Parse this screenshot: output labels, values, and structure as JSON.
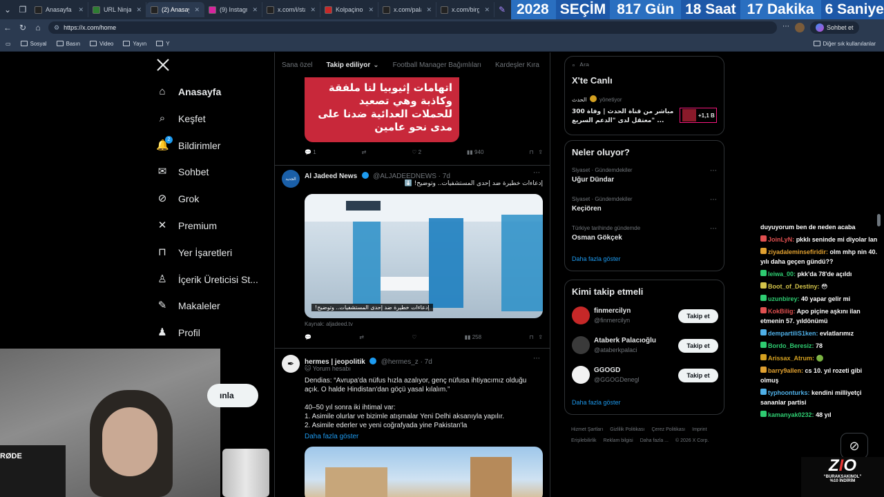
{
  "browser": {
    "tabs": [
      {
        "label": "Anasayfa / X",
        "color": "#222"
      },
      {
        "label": "URL Ninja (2...",
        "color": "#2e7d32"
      },
      {
        "label": "(2) Anasayfa",
        "color": "#222",
        "active": true
      },
      {
        "label": "(9) Instagram",
        "color": "#d6249f"
      },
      {
        "label": "x.com/i/statu",
        "color": "#222"
      },
      {
        "label": "Kolpaçino Ba",
        "color": "#c62828"
      },
      {
        "label": "x.com/palaz",
        "color": "#222"
      },
      {
        "label": "x.com/birgul",
        "color": "#222"
      }
    ],
    "countdown": {
      "year": "2028",
      "label": "SEÇİM",
      "days": "817 Gün",
      "hours": "18 Saat",
      "minutes": "17 Dakika",
      "seconds": "6 Saniye"
    },
    "url": "https://x.com/home",
    "chat_button": "Sohbet et",
    "bookmarks": [
      "Sosyal",
      "Basın",
      "Video",
      "Yayın",
      "Y"
    ],
    "other_bookmarks": "Diğer sık kullanılanlar"
  },
  "sidebar": {
    "items": [
      {
        "label": "Anasayfa",
        "icon": "home-icon"
      },
      {
        "label": "Keşfet",
        "icon": "search-icon"
      },
      {
        "label": "Bildirimler",
        "icon": "bell-icon",
        "badge": "2"
      },
      {
        "label": "Sohbet",
        "icon": "mail-icon"
      },
      {
        "label": "Grok",
        "icon": "grok-icon"
      },
      {
        "label": "Premium",
        "icon": "x-icon"
      },
      {
        "label": "Yer İşaretleri",
        "icon": "bookmark-icon"
      },
      {
        "label": "İçerik Üreticisi St...",
        "icon": "creator-icon"
      },
      {
        "label": "Makaleler",
        "icon": "article-icon"
      },
      {
        "label": "Profil",
        "icon": "person-icon"
      }
    ],
    "post_button_partial": "ınla"
  },
  "timeline": {
    "tabs": [
      "Sana özel",
      "Takip ediliyor",
      "Football Manager Bağımlıları",
      "Kardeşler Kıra"
    ],
    "tweet1": {
      "image_text": [
        "اتهامات إثيوبيا لنا ملفقة",
        "وكاذبة وهي تصعيد",
        "للحملات العدائية ضدنا على",
        "مدى نحو عامين"
      ],
      "replies": "1",
      "likes": "2",
      "views": "940"
    },
    "tweet2": {
      "name": "Al Jadeed News",
      "handle": "@ALJADEEDNEWS · 7d",
      "text": "إدعاءات خطيرة ضد إحدى المستشفيات.. وتوضيح! ⬇️",
      "image_caption": "إدعاءات خطيرة ضد إحدى المستشفيات.. وتوضيح!",
      "source": "Kaynak: aljadeed.tv",
      "views": "258"
    },
    "tweet3": {
      "name": "hermes | jeopolitik",
      "handle": "@hermes_z · 7d",
      "tag": "Yorum hesabı",
      "lines": [
        "Dendias: “Avrupa'da nüfus hızla azalıyor, genç nüfusa ihtiyacımız olduğu",
        "açık. O halde Hindistan'dan göçü yasal kılalım.”",
        "",
        "40–50 yıl sonra iki ihtimal var:",
        "1. Asimile olurlar ve bizimle atışmalar Yeni Delhi aksanıyla yapılır.",
        "2. Asimile ederler ve yeni coğrafyada yine Pakistan'la"
      ],
      "more": "Daha fazla göster"
    }
  },
  "right": {
    "search_placeholder": "Ara",
    "live": {
      "title": "X'te Canlı",
      "account": "الحدث",
      "status": "yönetiyor",
      "text_line1": "مباشر من قناة الحدث | وفاة 300",
      "text_line2": "معتقل لدى \"الدعم السريع\" ...",
      "count": "+1,1 B"
    },
    "trends": {
      "title": "Neler oluyor?",
      "items": [
        {
          "context": "Siyaset · Gündemdekiler",
          "name": "Uğur Dündar"
        },
        {
          "context": "Siyaset · Gündemdekiler",
          "name": "Keçiören"
        },
        {
          "context": "Türkiye tarihinde gündemde",
          "name": "Osman Gökçek"
        }
      ],
      "more": "Daha fazla göster"
    },
    "follow": {
      "title": "Kimi takip etmeli",
      "items": [
        {
          "name": "finmercilyn",
          "handle": "@finmercilyn",
          "color": "#c62828"
        },
        {
          "name": "Ataberk Palacıoğlu",
          "handle": "@ataberkpalaci",
          "color": "#3a3a3a"
        },
        {
          "name": "GGOGD",
          "handle": "@GGOGDenegl",
          "color": "#f2f2f2"
        }
      ],
      "button": "Takip et",
      "more": "Daha fazla göster"
    },
    "footer": [
      "Hizmet Şartları",
      "Gizlilik Politikası",
      "Çerez Politikası",
      "Imprint",
      "Erişilebilirlik",
      "Reklam bilgisi",
      "Daha fazla ...",
      "© 2026 X Corp."
    ]
  },
  "chat": {
    "messages": [
      {
        "user": "",
        "text": "duyuyorum ben de neden acaba",
        "color": "#ffffff"
      },
      {
        "user": "JoinLyN:",
        "text": "pkklı seninde mi diyolar lan",
        "color": "#e05050"
      },
      {
        "user": "ziyadaleminsefiridir:",
        "text": "olm mhp nin 40. yılı daha geçen gündü??",
        "color": "#e0a030"
      },
      {
        "user": "leiwa_00:",
        "text": "pkk'da 78'de açıldı",
        "color": "#2ecc71"
      },
      {
        "user": "Boot_of_Destiny:",
        "text": "😳",
        "color": "#d4c44a"
      },
      {
        "user": "uzunbirey:",
        "text": "40 yapar gelir mi",
        "color": "#2ecc71"
      },
      {
        "user": "KokBilig:",
        "text": "Apo piçine aşkını ilan etmenin 57. yıldönümü",
        "color": "#e05050"
      },
      {
        "user": "dempartiliS1ken:",
        "text": "evlatlarımız",
        "color": "#4fb0e8"
      },
      {
        "user": "Bordo_Beresiz:",
        "text": "78",
        "color": "#2ecc71"
      },
      {
        "user": "Arissax_Atrum:",
        "text": "🟢",
        "color": "#d4a020"
      },
      {
        "user": "barry9allen:",
        "text": "cs 10. yıl rozeti gibi olmuş",
        "color": "#e0a030"
      },
      {
        "user": "typhoonturks:",
        "text": "kendini milliyetçi sananlar partisi",
        "color": "#4fb0e8"
      },
      {
        "user": "kamanyak0232:",
        "text": "48 yıl",
        "color": "#2ecc71"
      }
    ]
  },
  "overlay": {
    "webcam_label": "RØDE",
    "promo_line1": "“BURAKSAKINOL”",
    "promo_line2": "%10 İNDİRİM"
  }
}
